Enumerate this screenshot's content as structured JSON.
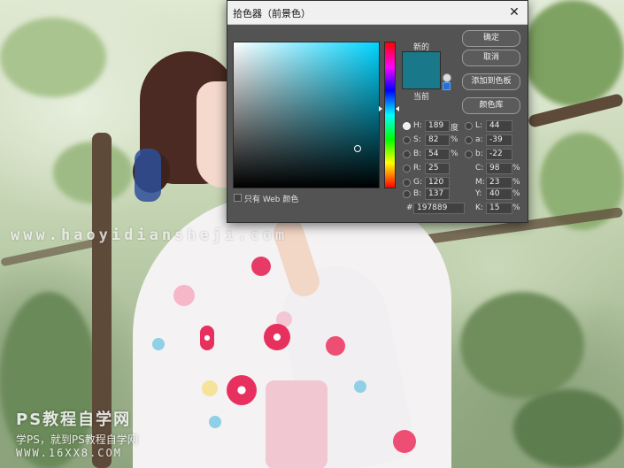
{
  "dialog": {
    "title": "拾色器（前景色）",
    "close_glyph": "✕",
    "new_label": "新的",
    "current_label": "当前",
    "new_color": "#197889",
    "current_color": "#197889",
    "buttons": {
      "ok": "确定",
      "cancel": "取消",
      "add_swatch": "添加到色板",
      "color_library": "颜色库"
    },
    "hsb": {
      "h": {
        "label": "H:",
        "value": "189",
        "unit": "度"
      },
      "s": {
        "label": "S:",
        "value": "82",
        "unit": "%"
      },
      "b": {
        "label": "B:",
        "value": "54",
        "unit": "%"
      }
    },
    "rgb": {
      "r": {
        "label": "R:",
        "value": "25"
      },
      "g": {
        "label": "G:",
        "value": "120"
      },
      "b": {
        "label": "B:",
        "value": "137"
      }
    },
    "lab": {
      "l": {
        "label": "L:",
        "value": "44"
      },
      "a": {
        "label": "a:",
        "value": "-39"
      },
      "b": {
        "label": "b:",
        "value": "-22"
      }
    },
    "cmyk": {
      "c": {
        "label": "C:",
        "value": "98",
        "unit": "%"
      },
      "m": {
        "label": "M:",
        "value": "23",
        "unit": "%"
      },
      "y": {
        "label": "Y:",
        "value": "40",
        "unit": "%"
      },
      "k": {
        "label": "K:",
        "value": "15",
        "unit": "%"
      }
    },
    "hex": {
      "label": "#",
      "value": "197889"
    },
    "web_only_label": "只有 Web 颜色",
    "selected_mode": "H"
  },
  "background": {
    "watermark_text": "www.haoyidiansheji.com",
    "logo_line1": "PS教程自学网",
    "logo_line2": "学PS，就到PS教程自学网",
    "logo_line3": "WWW.16XX8.COM"
  }
}
